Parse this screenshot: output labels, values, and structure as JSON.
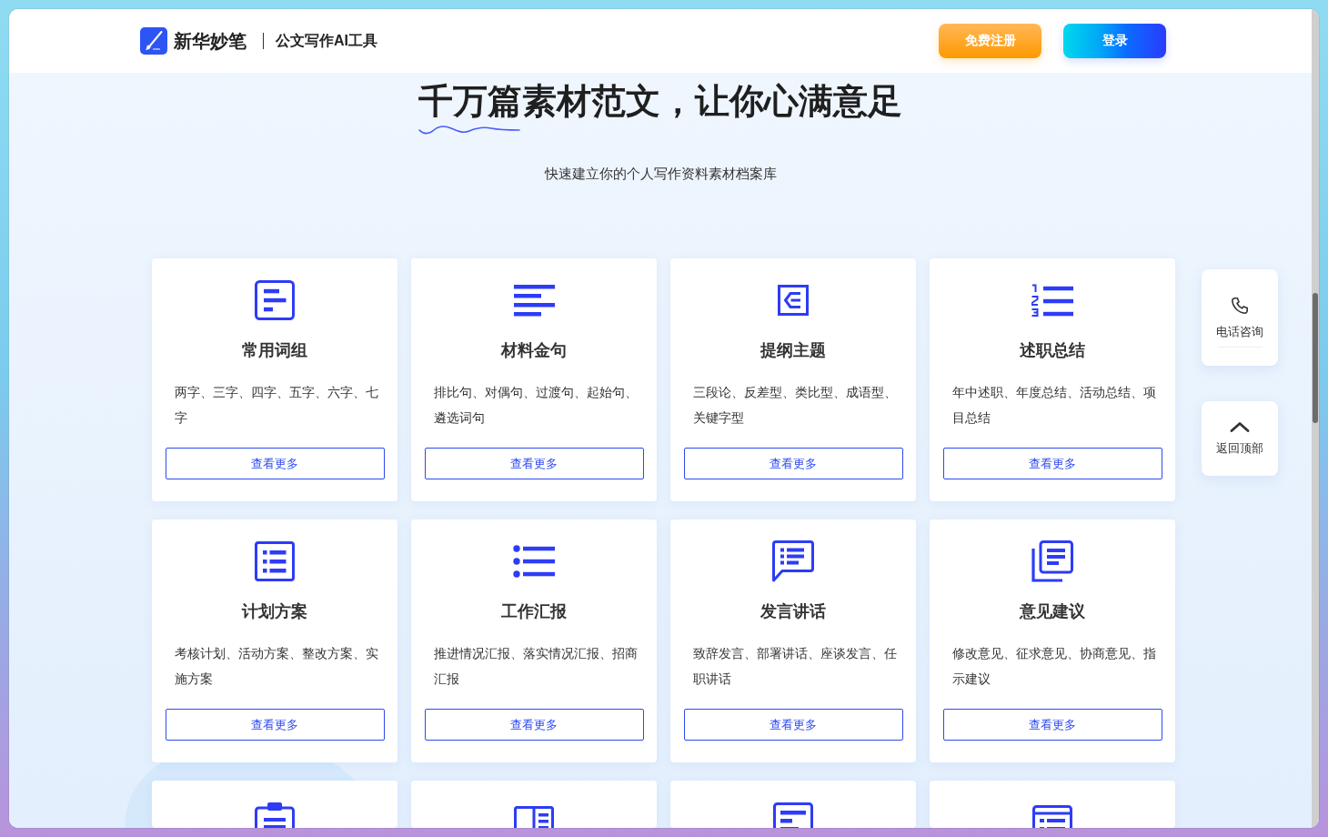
{
  "header": {
    "brand": "新华妙笔",
    "product": "公文写作AI工具",
    "buttons": [
      {
        "label": "免费注册",
        "kind": "register"
      },
      {
        "label": "登录",
        "kind": "login"
      }
    ]
  },
  "hero": {
    "title": "千万篇素材范文，让你心满意足",
    "subtitle": "快速建立你的个人写作资料素材档案库"
  },
  "categories": [
    {
      "kind": "document",
      "title": "常用词组",
      "description": "两字、三字、四字、五字、六字、七字",
      "button": "查看更多"
    },
    {
      "kind": "lines",
      "title": "材料金句",
      "description": "排比句、对偶句、过渡句、起始句、遴选词句",
      "button": "查看更多"
    },
    {
      "kind": "outline",
      "title": "提纲主题",
      "description": "三段论、反差型、类比型、成语型、关键字型",
      "button": "查看更多"
    },
    {
      "kind": "numbered",
      "title": "述职总结",
      "description": "年中述职、年度总结、活动总结、项目总结",
      "button": "查看更多"
    },
    {
      "kind": "table",
      "title": "计划方案",
      "description": "考核计划、活动方案、整改方案、实施方案",
      "button": "查看更多"
    },
    {
      "kind": "bullets",
      "title": "工作汇报",
      "description": "推进情况汇报、落实情况汇报、招商汇报",
      "button": "查看更多"
    },
    {
      "kind": "speech",
      "title": "发言讲话",
      "description": "致辞发言、部署讲话、座谈发言、任职讲话",
      "button": "查看更多"
    },
    {
      "kind": "copies",
      "title": "意见建议",
      "description": "修改意见、征求意见、协商意见、指示建议",
      "button": "查看更多"
    },
    {
      "kind": "clipboard"
    },
    {
      "kind": "book"
    },
    {
      "kind": "form"
    },
    {
      "kind": "panel"
    }
  ],
  "side_tools": [
    {
      "label": "电话咨询",
      "kind": "phone"
    },
    {
      "label": "返回顶部",
      "kind": "top"
    }
  ]
}
